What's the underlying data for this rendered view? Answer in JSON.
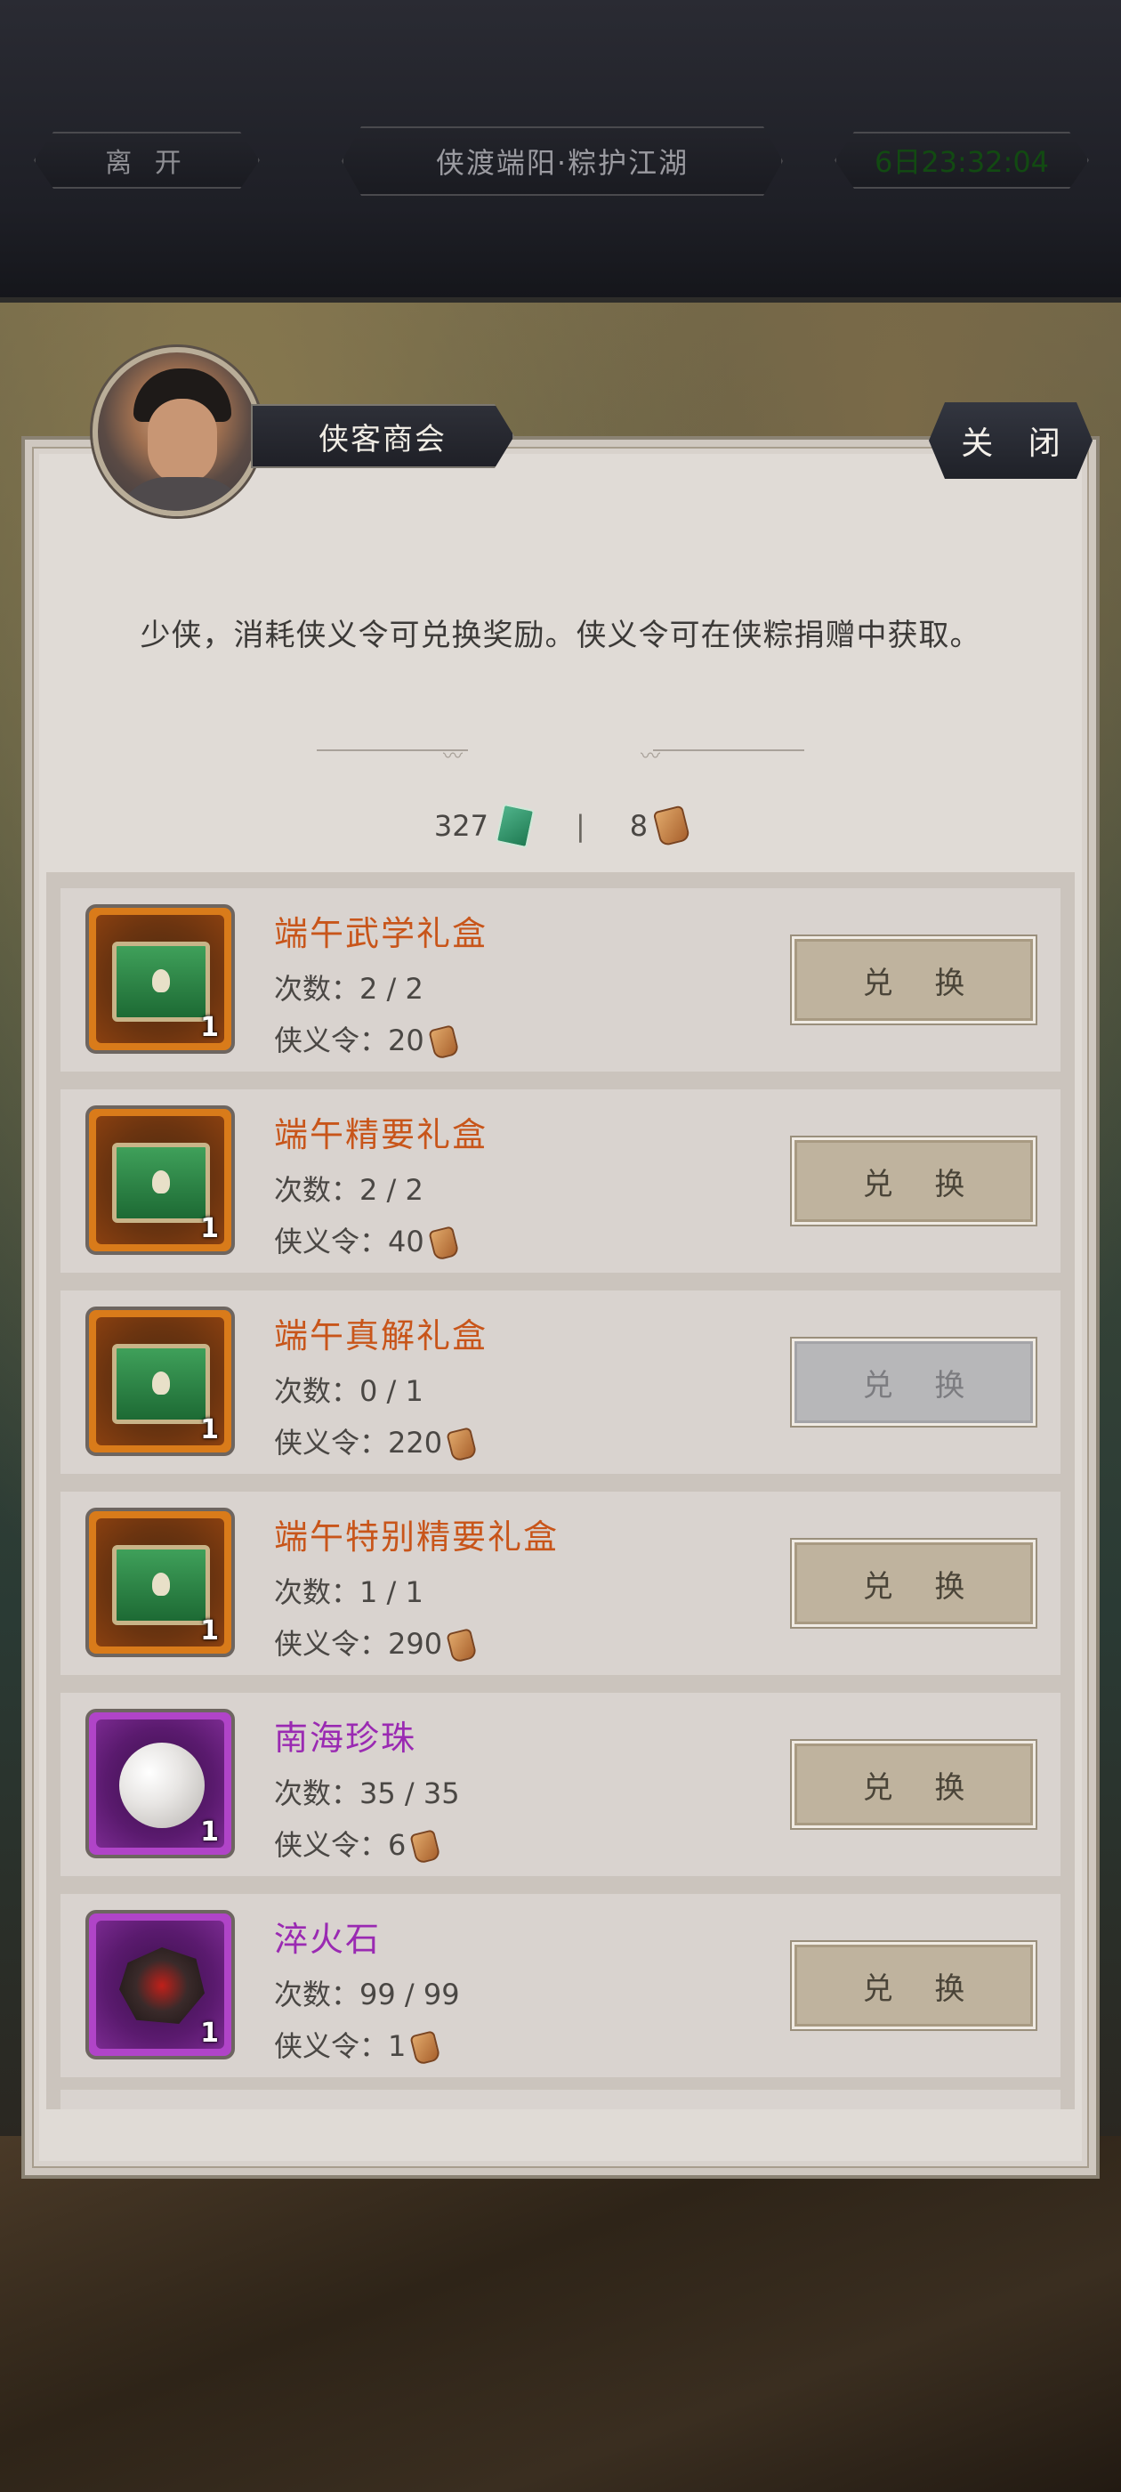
{
  "header": {
    "leave_label": "离 开",
    "title": "侠渡端阳·粽护江湖",
    "timer": "6日23:32:04"
  },
  "panel": {
    "npc_name": "侠客商会",
    "close_label": "关 闭",
    "description": "少侠，消耗侠义令可兑换奖励。侠义令可在侠粽捐赠中获取。",
    "currency": {
      "jade_amount": "327",
      "jade_icon": "jade-token-icon",
      "token_amount": "8",
      "token_icon": "xiayi-token-icon"
    }
  },
  "count_prefix": "次数：",
  "cost_prefix": "侠义令：",
  "items": [
    {
      "name": "端午武学礼盒",
      "count": "2 / 2",
      "cost": "20",
      "qty": "1",
      "rarity": "orange",
      "icon": "gift-chest-icon",
      "button": "兑 换",
      "enabled": true
    },
    {
      "name": "端午精要礼盒",
      "count": "2 / 2",
      "cost": "40",
      "qty": "1",
      "rarity": "orange",
      "icon": "gift-chest-icon",
      "button": "兑 换",
      "enabled": true
    },
    {
      "name": "端午真解礼盒",
      "count": "0 / 1",
      "cost": "220",
      "qty": "1",
      "rarity": "orange",
      "icon": "gift-chest-icon",
      "button": "兑 换",
      "enabled": false
    },
    {
      "name": "端午特别精要礼盒",
      "count": "1 / 1",
      "cost": "290",
      "qty": "1",
      "rarity": "orange",
      "icon": "gift-chest-icon",
      "button": "兑 换",
      "enabled": true
    },
    {
      "name": "南海珍珠",
      "count": "35 / 35",
      "cost": "6",
      "qty": "1",
      "rarity": "purple",
      "icon": "pearl-icon",
      "button": "兑 换",
      "enabled": true
    },
    {
      "name": "淬火石",
      "count": "99 / 99",
      "cost": "1",
      "qty": "1",
      "rarity": "purple",
      "icon": "fire-stone-icon",
      "button": "兑 换",
      "enabled": true
    }
  ],
  "colors": {
    "orange_rarity": "#d97b1a",
    "purple_rarity": "#b044c8",
    "timer_green": "#124a12"
  }
}
